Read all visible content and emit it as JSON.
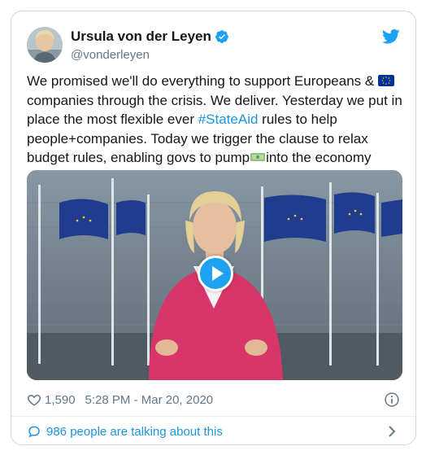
{
  "tweet": {
    "author": {
      "display_name": "Ursula von der Leyen",
      "handle": "@vonderleyen",
      "verified": true,
      "avatar_icon": "profile-photo"
    },
    "text": {
      "part1": "We promised we'll do everything to support Europeans & ",
      "emoji_flag": "eu-flag-emoji",
      "part2": " companies through the crisis. We deliver. Yesterday we put in place the most flexible ever ",
      "hashtag": "#StateAid",
      "part3": " rules to help people+companies. Today we trigger the clause to relax budget rules, enabling govs to pump",
      "emoji_money": "banknote-emoji",
      "part4": "into the economy"
    },
    "media": {
      "type": "video",
      "play_icon": "play-icon"
    },
    "likes": "1,590",
    "timestamp": "5:28 PM - Mar 20, 2020",
    "talking": "986 people are talking about this"
  },
  "colors": {
    "accent": "#1da1f2",
    "link": "#1b95e0",
    "muted": "#657786",
    "text": "#14171a",
    "border": "#cfd9de"
  }
}
